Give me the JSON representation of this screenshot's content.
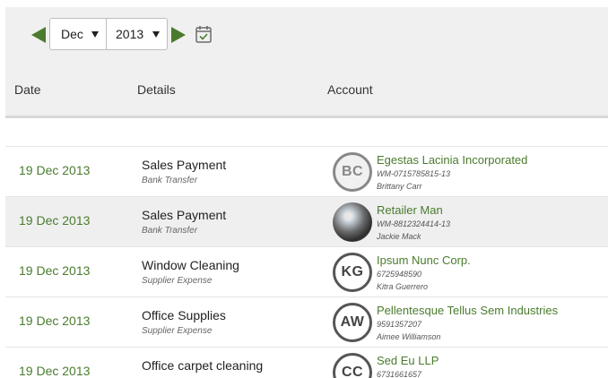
{
  "nav": {
    "month": "Dec",
    "year": "2013"
  },
  "columns": {
    "date": "Date",
    "details": "Details",
    "account": "Account"
  },
  "colors": {
    "accent": "#4a7b2e",
    "row_alt": "#efefef"
  },
  "rows": [
    {
      "date": "19 Dec 2013",
      "title": "Sales Payment",
      "subtitle": "Bank Transfer",
      "avatar": "BC",
      "account": "Egestas Lacinia Incorporated",
      "account_number": "WM-0715785815-13",
      "contact": "Brittany Carr"
    },
    {
      "date": "19 Dec 2013",
      "title": "Sales Payment",
      "subtitle": "Bank Transfer",
      "avatar": "",
      "account": "Retailer Man",
      "account_number": "WM-8812324414-13",
      "contact": "Jackie Mack"
    },
    {
      "date": "19 Dec 2013",
      "title": "Window Cleaning",
      "subtitle": "Supplier Expense",
      "avatar": "KG",
      "account": "Ipsum Nunc Corp.",
      "account_number": "6725948590",
      "contact": "Kitra Guerrero"
    },
    {
      "date": "19 Dec 2013",
      "title": "Office Supplies",
      "subtitle": "Supplier Expense",
      "avatar": "AW",
      "account": "Pellentesque Tellus Sem Industries",
      "account_number": "9591357207",
      "contact": "Aimee Williamson"
    },
    {
      "date": "19 Dec 2013",
      "title": "Office carpet cleaning",
      "subtitle": "",
      "avatar": "CC",
      "account": "Sed Eu LLP",
      "account_number": "6731661657",
      "contact": ""
    }
  ]
}
